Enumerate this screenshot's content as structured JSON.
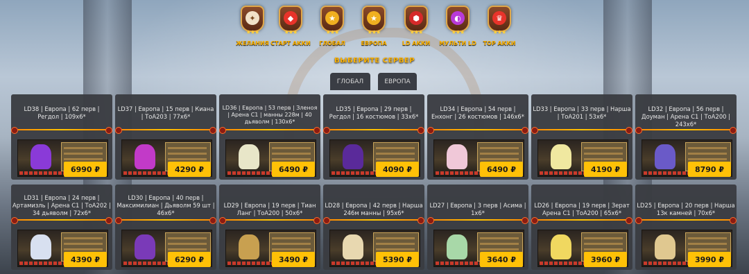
{
  "categories": [
    {
      "label": "ЖЕЛАНИЯ",
      "icon": "wings-icon",
      "color": "#f2e2c8"
    },
    {
      "label": "СТАРТ АККИ",
      "icon": "red-gem-icon",
      "color": "#e8332a"
    },
    {
      "label": "ГЛОБАЛ",
      "icon": "gold-star-icon",
      "color": "#f0b020"
    },
    {
      "label": "ЕВРОПА",
      "icon": "gold-star-icon",
      "color": "#f0b020"
    },
    {
      "label": "LD АККИ",
      "icon": "red-dice-icon",
      "color": "#d62a2a"
    },
    {
      "label": "МУЛЬТИ LD",
      "icon": "dual-orb-icon",
      "color": "#b83ad8"
    },
    {
      "label": "TOP АККИ",
      "icon": "red-crown-icon",
      "color": "#e8332a"
    }
  ],
  "server_title": "ВЫБЕРИТЕ СЕРВЕР",
  "tabs": [
    {
      "label": "ГЛОБАЛ"
    },
    {
      "label": "ЕВРОПА"
    }
  ],
  "accent_color": "#ffc107",
  "cards": [
    {
      "title": "LD38 | Европа | 62 перв | Регдол | 109х6*",
      "price": "6990 ₽",
      "hero_color": "#8a3ad8"
    },
    {
      "title": "LD37 | Европа | 15 перв | Киана | ТоА203 | 77х6*",
      "price": "4290 ₽",
      "hero_color": "#c23ac8"
    },
    {
      "title": "LD36 | Европа | 53 перв | Зленоя | Арена С1 | манны 228м | 40 дьяволм | 130х6*",
      "price": "6490 ₽",
      "hero_color": "#e8e6c8"
    },
    {
      "title": "LD35 | Европа | 29 перв | Регдол | 16 костюмов | 33х6*",
      "price": "4090 ₽",
      "hero_color": "#5a2a9a"
    },
    {
      "title": "LD34 | Европа | 54 перв | Енхонг | 26 костюмов | 146х6*",
      "price": "6490 ₽",
      "hero_color": "#f0c8d8"
    },
    {
      "title": "LD33 | Европа | 33 перв | Нарша | ТоА201 | 53х6*",
      "price": "4190 ₽",
      "hero_color": "#f0e8a0"
    },
    {
      "title": "LD32 | Европа | 56 перв | Доуман | Арена С1 | ТоА200 | 243х6*",
      "price": "8790 ₽",
      "hero_color": "#6a5ac8"
    },
    {
      "title": "LD31 | Европа | 24 перв | Артамизль | Арена С1 | ТоА202 | 34 дьяволм | 72х6*",
      "price": "4390 ₽",
      "hero_color": "#d8e0f0"
    },
    {
      "title": "LD30 | Европа | 40 перв | Максимилиан | Дьяволм 59 шт | 46х6*",
      "price": "6290 ₽",
      "hero_color": "#7a3ab8"
    },
    {
      "title": "LD29 | Европа | 19 перв | Тиан Ланг | ТоА200 | 50х6*",
      "price": "3490 ₽",
      "hero_color": "#c8a050"
    },
    {
      "title": "LD28 | Европа | 42 перв | Нарша 246м манны | 95х6*",
      "price": "5390 ₽",
      "hero_color": "#e8d8b0"
    },
    {
      "title": "LD27 | Европа | 3 перв | Асима | 1х6*",
      "price": "3640 ₽",
      "hero_color": "#a8d8a8"
    },
    {
      "title": "LD26 | Европа | 19 перв | Зерат Арена С1 | ТоА200 | 65х6*",
      "price": "3960 ₽",
      "hero_color": "#f0d860"
    },
    {
      "title": "LD25 | Европа | 20 перв | Нарша 13к камней | 70х6*",
      "price": "3990 ₽",
      "hero_color": "#e0c890"
    }
  ]
}
